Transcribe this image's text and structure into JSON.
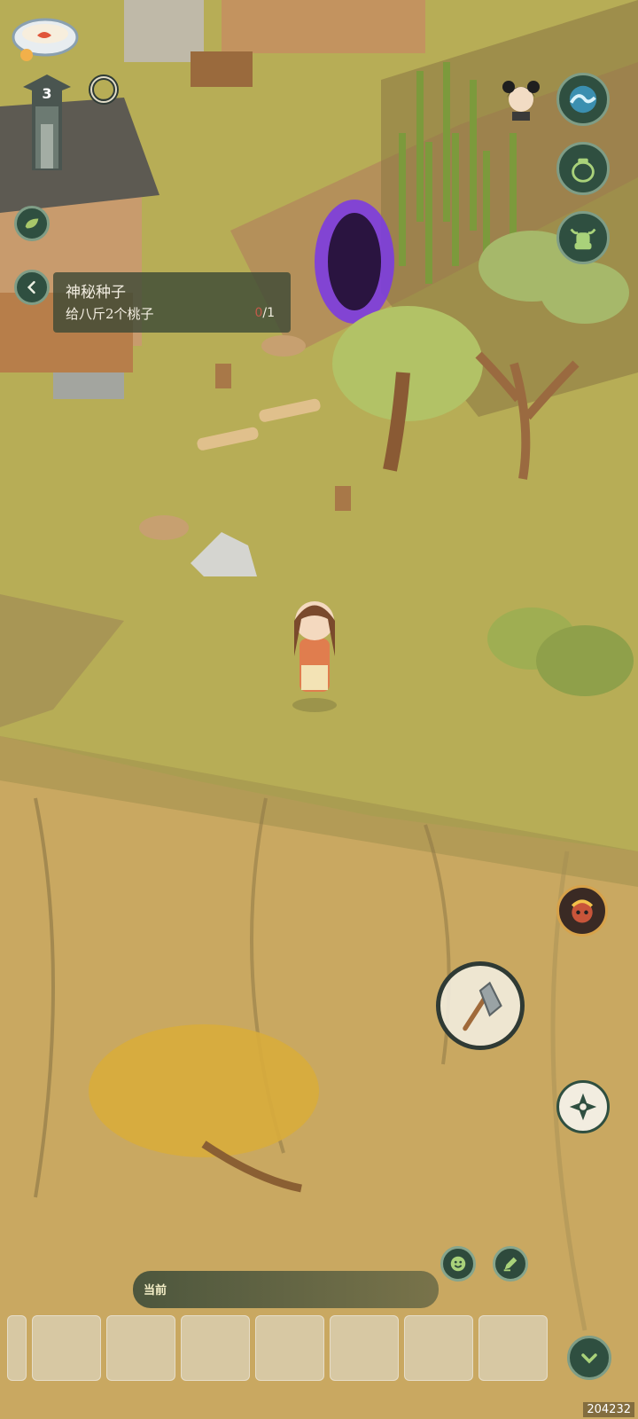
{
  "level_badge": {
    "number": "3"
  },
  "quest": {
    "title": "神秘种子",
    "description": "给八斤2个桃子",
    "progress_have": "0",
    "progress_sep_total": "/1"
  },
  "chat": {
    "channel_label": "当前"
  },
  "hotbar": {
    "slots": [
      "",
      "",
      "",
      "",
      "",
      "",
      ""
    ]
  },
  "watermark": "204232",
  "icons": {
    "bowl": "goldfish-bowl-icon",
    "tablet": "stone-tablet-icon",
    "ring": "ring-icon",
    "leaf": "leaf-icon",
    "back": "chevron-left-icon",
    "portrait": "npc-portrait-icon",
    "wave": "wave-skill-icon",
    "pot": "pot-icon",
    "cow": "ox-icon",
    "monkey": "monkey-king-icon",
    "axe": "axe-icon",
    "compass": "compass-icon",
    "smile": "emoji-icon",
    "edit": "edit-icon",
    "down": "chevron-down-icon"
  },
  "colors": {
    "grass": "#b7ad56",
    "cliff": "#c9a861",
    "button_bg": "#2f4f40",
    "portal": "#7c3ce0",
    "quest_bg": "#384634"
  }
}
